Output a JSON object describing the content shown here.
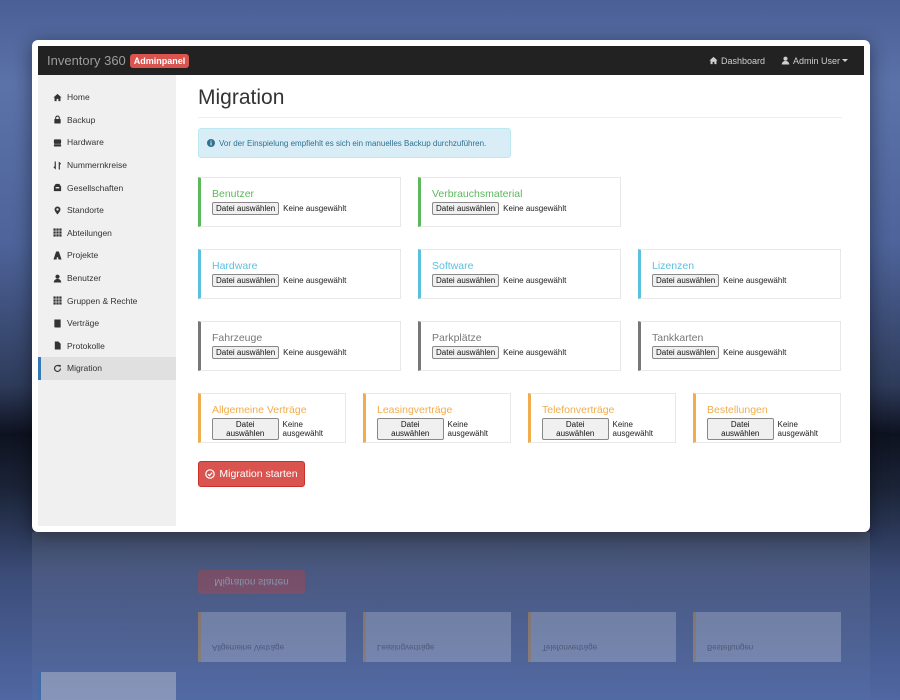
{
  "navbar": {
    "brand": "Inventory 360",
    "badge": "Adminpanel",
    "dashboard": "Dashboard",
    "user": "Admin User"
  },
  "sidebar": {
    "items": [
      {
        "label": "Home",
        "icon": "home-icon"
      },
      {
        "label": "Backup",
        "icon": "lock-icon"
      },
      {
        "label": "Hardware",
        "icon": "hdd-icon"
      },
      {
        "label": "Nummernkreise",
        "icon": "sort-icon"
      },
      {
        "label": "Gesellschaften",
        "icon": "tray-icon"
      },
      {
        "label": "Standorte",
        "icon": "map-marker-icon"
      },
      {
        "label": "Abteilungen",
        "icon": "grid-icon"
      },
      {
        "label": "Projekte",
        "icon": "road-icon"
      },
      {
        "label": "Benutzer",
        "icon": "user-icon"
      },
      {
        "label": "Gruppen & Rechte",
        "icon": "grid-icon"
      },
      {
        "label": "Verträge",
        "icon": "book-icon"
      },
      {
        "label": "Protokolle",
        "icon": "file-icon"
      },
      {
        "label": "Migration",
        "icon": "refresh-icon",
        "active": true
      }
    ]
  },
  "main": {
    "title": "Migration",
    "alert": "Vor der Einspielung empfiehlt es sich ein manuelles Backup durchzuführen.",
    "file_button": "Datei auswählen",
    "no_file": "Keine ausgewählt",
    "panels": [
      {
        "label": "Benutzer",
        "color": "#5cb85c"
      },
      {
        "label": "Verbrauchsmaterial",
        "color": "#5cb85c"
      },
      {
        "label": "Hardware",
        "color": "#5bc0de"
      },
      {
        "label": "Software",
        "color": "#5bc0de"
      },
      {
        "label": "Lizenzen",
        "color": "#5bc0de"
      },
      {
        "label": "Fahrzeuge",
        "color": "#777777"
      },
      {
        "label": "Parkplätze",
        "color": "#777777"
      },
      {
        "label": "Tankkarten",
        "color": "#777777"
      },
      {
        "label": "Allgemeine Verträge",
        "color": "#f0ad4e"
      },
      {
        "label": "Leasingverträge",
        "color": "#f0ad4e"
      },
      {
        "label": "Telefonverträge",
        "color": "#f0ad4e"
      },
      {
        "label": "Bestellungen",
        "color": "#f0ad4e"
      }
    ],
    "start_button": "Migration starten"
  }
}
